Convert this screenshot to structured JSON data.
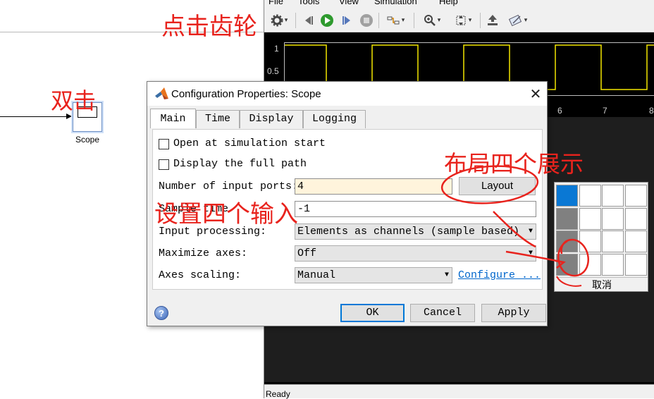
{
  "scope_block": {
    "label": "Scope"
  },
  "scope_window": {
    "menu": [
      "File",
      "Tools",
      "View",
      "Simulation",
      "Help"
    ],
    "toolbar_icons": [
      "gear-icon",
      "step-back-icon",
      "run-icon",
      "step-forward-icon",
      "stop-icon",
      "highlight-icon",
      "zoom-in-icon",
      "zoom-fit-icon",
      "triggers-icon",
      "measurements-icon"
    ],
    "y_ticks": [
      "1",
      "0.5"
    ],
    "x_ticks": [
      "6",
      "7",
      "8"
    ],
    "status": "Ready"
  },
  "dialog": {
    "title": "Configuration Properties: Scope",
    "tabs": [
      "Main",
      "Time",
      "Display",
      "Logging"
    ],
    "active_tab": "Main",
    "open_at_start_label": "Open at simulation start",
    "full_path_label": "Display the full path",
    "num_ports_label": "Number of input ports:",
    "num_ports_value": "4",
    "layout_button": "Layout",
    "sample_time_label": "Sample time",
    "sample_time_value": "-1",
    "input_processing_label": "Input processing:",
    "input_processing_value": "Elements as channels (sample based)",
    "maximize_axes_label": "Maximize axes:",
    "maximize_axes_value": "Off",
    "axes_scaling_label": "Axes scaling:",
    "axes_scaling_value": "Manual",
    "configure_link": "Configure ...",
    "ok": "OK",
    "cancel": "Cancel",
    "apply": "Apply"
  },
  "layout_popup": {
    "cancel": "取消"
  },
  "annotations": {
    "click_gear": "点击齿轮",
    "double_click": "双击",
    "layout_four": "布局四个展示",
    "set_four_inputs": "设置四个输入"
  },
  "colors": {
    "annotation_red": "#e8231d",
    "signal_yellow": "#f2e500",
    "selected_blue": "#0a78d4",
    "highlight_field": "#fff4dc"
  }
}
